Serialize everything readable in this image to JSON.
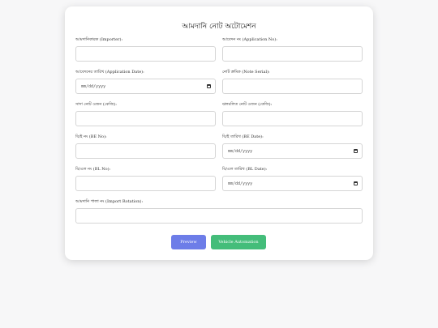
{
  "form": {
    "title": "আমদানি নোট অটোমেশন",
    "fields": [
      {
        "label": "আমদানিকারক (Importer):",
        "value": ""
      },
      {
        "label": "আবেদন নং (Application No):",
        "value": ""
      },
      {
        "label": "আবেদনের তারিখ (Application Date):",
        "value": "mm/dd/yyyy"
      },
      {
        "label": "নোট ক্রমিক (Note Serial):",
        "value": ""
      },
      {
        "label": "সাদা নোট ওজন (কেজি):",
        "value": ""
      },
      {
        "label": "ঝলমলিত নোট ওজন (কেজি):",
        "value": ""
      },
      {
        "label": "বি/ই নং (BE No):",
        "value": ""
      },
      {
        "label": "বি/ই তারিখ (BE Date):",
        "value": "mm/dd/yyyy"
      },
      {
        "label": "বি/এল নং (BL No):",
        "value": ""
      },
      {
        "label": "বি/এল তারিখ (BL Date):",
        "value": "mm/dd/yyyy"
      },
      {
        "label": "আমদানি পালা নং (Import Rotation):",
        "value": ""
      }
    ],
    "buttons": {
      "preview": "Preview",
      "automation": "Vehicle Automation"
    }
  }
}
